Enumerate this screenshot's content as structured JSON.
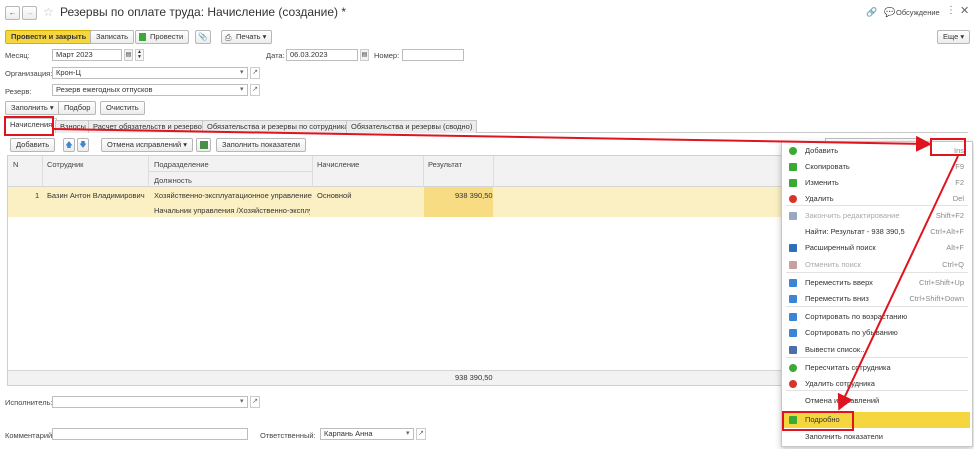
{
  "window": {
    "title": "Резервы по оплате труда: Начисление (создание) *",
    "discussion": "Обсуждение"
  },
  "toolbar": {
    "post_close": "Провести и закрыть",
    "save": "Записать",
    "post": "Провести",
    "print": "Печать",
    "more": "Еще"
  },
  "form": {
    "month_label": "Месяц:",
    "month_value": "Март 2023",
    "date_label": "Дата:",
    "date_value": "06.03.2023",
    "number_label": "Номер:",
    "number_value": "",
    "org_label": "Организация:",
    "org_value": "Крон-Ц",
    "reserve_label": "Резерв:",
    "reserve_value": "Резерв ежегодных отпусков"
  },
  "actions": {
    "fill": "Заполнить",
    "select": "Подбор",
    "clear": "Очистить"
  },
  "tabs": [
    "Начисления",
    "Взносы",
    "Расчет обязательств и резервов",
    "Обязательства и резервы по сотрудникам",
    "Обязательства и резервы (сводно)"
  ],
  "table_toolbar": {
    "add": "Добавить",
    "corrections": "Отмена исправлений",
    "fill_indicators": "Заполнить показатели"
  },
  "table": {
    "headers": {
      "n": "N",
      "employee": "Сотрудник",
      "department": "Подразделение",
      "position": "Должность",
      "accrual": "Начисление",
      "result": "Результат"
    },
    "rows": [
      {
        "n": "1",
        "employee": "Базин Антон Владимирович",
        "department": "Хозяйственно-эксплуатационное управление",
        "position": "Начальник управления /Хозяйственно-эксплу...",
        "accrual": "Основной",
        "result": "938 390,50"
      }
    ],
    "total": "938 390,50"
  },
  "footer": {
    "executor_label": "Исполнитель:",
    "executor_value": "",
    "comment_label": "Комментарий:",
    "comment_value": "",
    "responsible_label": "Ответственный:",
    "responsible_value": "Карпань Анна"
  },
  "context_menu": [
    {
      "label": "Добавить",
      "shortcut": "Ins",
      "icon": "plus-icon",
      "color": "#3aa935"
    },
    {
      "label": "Скопировать",
      "shortcut": "F9",
      "icon": "copy-icon",
      "color": "#3aa935"
    },
    {
      "label": "Изменить",
      "shortcut": "F2",
      "icon": "pencil-icon",
      "color": "#3aa935"
    },
    {
      "label": "Удалить",
      "shortcut": "Del",
      "icon": "delete-icon",
      "color": "#d9342b"
    },
    {
      "label": "Закончить редактирование",
      "shortcut": "Shift+F2",
      "icon": "finish-edit-icon",
      "color": "#9aa8c0",
      "disabled": true
    },
    {
      "label": "Найти: Результат - 938 390,5",
      "shortcut": "Ctrl+Alt+F",
      "icon": ""
    },
    {
      "label": "Расширенный поиск",
      "shortcut": "Alt+F",
      "icon": "search-icon",
      "color": "#2f6fb7"
    },
    {
      "label": "Отменить поиск",
      "shortcut": "Ctrl+Q",
      "icon": "cancel-search-icon",
      "color": "#c9a0a0",
      "disabled": true
    },
    {
      "label": "Переместить вверх",
      "shortcut": "Ctrl+Shift+Up",
      "icon": "arrow-up-icon",
      "color": "#3a86d4"
    },
    {
      "label": "Переместить вниз",
      "shortcut": "Ctrl+Shift+Down",
      "icon": "arrow-down-icon",
      "color": "#3a86d4"
    },
    {
      "label": "Сортировать по возрастанию",
      "shortcut": "",
      "icon": "sort-asc-icon",
      "color": "#3a86d4"
    },
    {
      "label": "Сортировать по убыванию",
      "shortcut": "",
      "icon": "sort-desc-icon",
      "color": "#3a86d4"
    },
    {
      "label": "Вывести список...",
      "shortcut": "",
      "icon": "list-icon",
      "color": "#4b6fa8"
    },
    {
      "label": "Пересчитать сотрудника",
      "shortcut": "",
      "icon": "recalc-icon",
      "color": "#3aa935"
    },
    {
      "label": "Удалить сотрудника",
      "shortcut": "",
      "icon": "delete-employee-icon",
      "color": "#d9342b"
    },
    {
      "label": "Отмена исправлений",
      "shortcut": "",
      "icon": ""
    },
    {
      "label": "Подробно",
      "shortcut": "",
      "icon": "details-icon",
      "color": "#3aa935",
      "highlighted": true
    },
    {
      "label": "Заполнить показатели",
      "shortcut": "",
      "icon": ""
    }
  ],
  "colors": {
    "accent_yellow": "#f6d63e",
    "annotation_red": "#e0141e",
    "row_highlight": "#fbf0c4",
    "result_highlight": "#f7dc84"
  }
}
